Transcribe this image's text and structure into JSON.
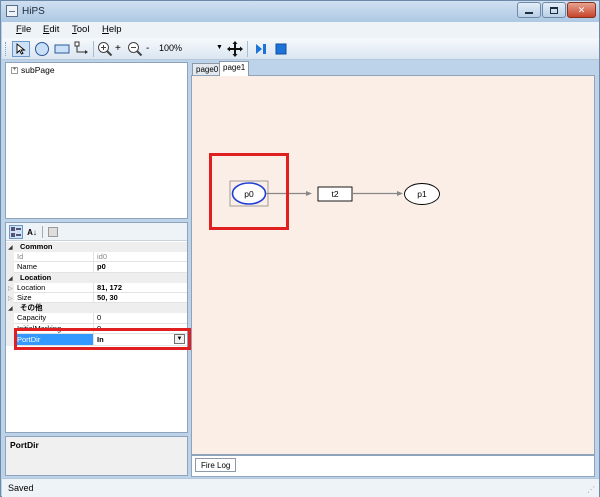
{
  "window": {
    "title": "HiPS"
  },
  "menu": [
    {
      "label": "File",
      "key": "F",
      "rest": "ile"
    },
    {
      "label": "Edit",
      "key": "E",
      "rest": "dit"
    },
    {
      "label": "Tool",
      "key": "T",
      "rest": "ool"
    },
    {
      "label": "Help",
      "key": "H",
      "rest": "elp"
    }
  ],
  "toolbar": {
    "zoom": "100%",
    "zoom_in_sign": "+",
    "zoom_out_sign": "-"
  },
  "tree": {
    "root": "subPage",
    "expander": "+"
  },
  "properties": {
    "rows": [
      {
        "kind": "cat",
        "name": "Common"
      },
      {
        "kind": "prop",
        "name": "Id",
        "value": "id0",
        "readonly": true
      },
      {
        "kind": "prop",
        "name": "Name",
        "value": "p0",
        "bold": true
      },
      {
        "kind": "cat",
        "name": "Location"
      },
      {
        "kind": "prop",
        "name": "Location",
        "value": "81, 172",
        "bold": true,
        "expandable": true
      },
      {
        "kind": "prop",
        "name": "Size",
        "value": "50, 30",
        "bold": true,
        "expandable": true
      },
      {
        "kind": "cat",
        "name": "その他"
      },
      {
        "kind": "prop",
        "name": "Capacity",
        "value": "0"
      },
      {
        "kind": "prop",
        "name": "InitialMarking",
        "value": "0"
      },
      {
        "kind": "prop",
        "name": "PortDir",
        "value": "In",
        "bold": true,
        "selected": true,
        "dropdown": true
      }
    ],
    "description_title": "PortDir"
  },
  "tabs": [
    "page0",
    "page1"
  ],
  "active_tab": "page1",
  "diagram": {
    "places": [
      {
        "label": "p0",
        "selected": true
      },
      {
        "label": "p1",
        "selected": false
      }
    ],
    "transitions": [
      {
        "label": "t2"
      }
    ]
  },
  "log": {
    "tab": "Fire Log"
  },
  "status": {
    "text": "Saved"
  },
  "colors": {
    "highlight": "#e02020",
    "canvas": "#faeee6",
    "selection": "#3399ff"
  }
}
